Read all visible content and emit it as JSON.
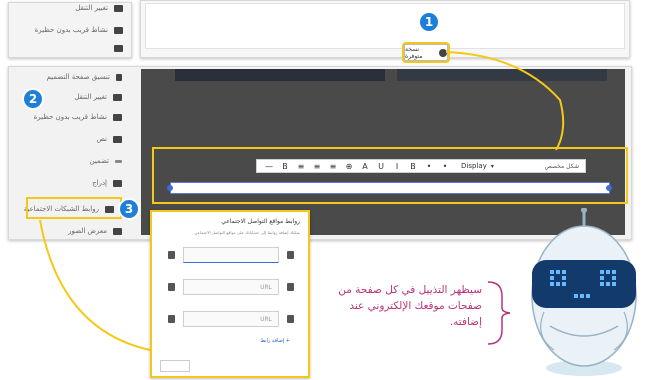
{
  "sidebar_top": {
    "items": [
      {
        "label": "تغيير التنقل",
        "icon": "page-icon"
      },
      {
        "label": "نشاط قريب بدون حظيرة",
        "icon": "image-icon"
      },
      {
        "label": "",
        "icon": "page-icon"
      }
    ]
  },
  "top_editor": {
    "new_section_label": "نسخة متوفرة"
  },
  "sidebar_main": {
    "items": [
      {
        "label": "تنسيق صفحة التصميم",
        "icon": "upload-icon"
      },
      {
        "label": "تغيير التنقل",
        "icon": "page-icon"
      },
      {
        "label": "نشاط قريب بدون حظيرة",
        "icon": "image-icon"
      },
      {
        "label": "نص",
        "icon": "text-icon"
      },
      {
        "label": "تضمين",
        "icon": "embed-icon"
      },
      {
        "label": "إدراج",
        "icon": "insert-icon"
      },
      {
        "label": "روابط الشبكات الاجتماعية",
        "icon": "social-links-icon"
      },
      {
        "label": "معرض الصور",
        "icon": "gallery-icon"
      }
    ]
  },
  "toolbar": {
    "style_label": "شكل مخصص",
    "font_select": "Display",
    "buttons": [
      "—",
      "B",
      "≡",
      "≡",
      "≡",
      "⊕",
      "A",
      "U",
      "I",
      "B",
      "•",
      "•"
    ]
  },
  "social_panel": {
    "title": "روابط مواقع التواصل الاجتماعي",
    "subtitle": "يمكنك إضافة روابط إلى حساباتك على مواقع التواصل الاجتماعي",
    "fields": [
      "",
      "URL",
      "URL"
    ],
    "add_link": "+ إضافة رابط"
  },
  "callout": {
    "text": "سيظهر التذييل في كل صفحة من صفحات موقعك الإلكتروني عند إضافته."
  },
  "badges": [
    "1",
    "2",
    "3"
  ],
  "colors": {
    "badge_blue": "#1e7fd9",
    "highlight_yellow": "#f5c718",
    "callout_text": "#b8337a"
  }
}
